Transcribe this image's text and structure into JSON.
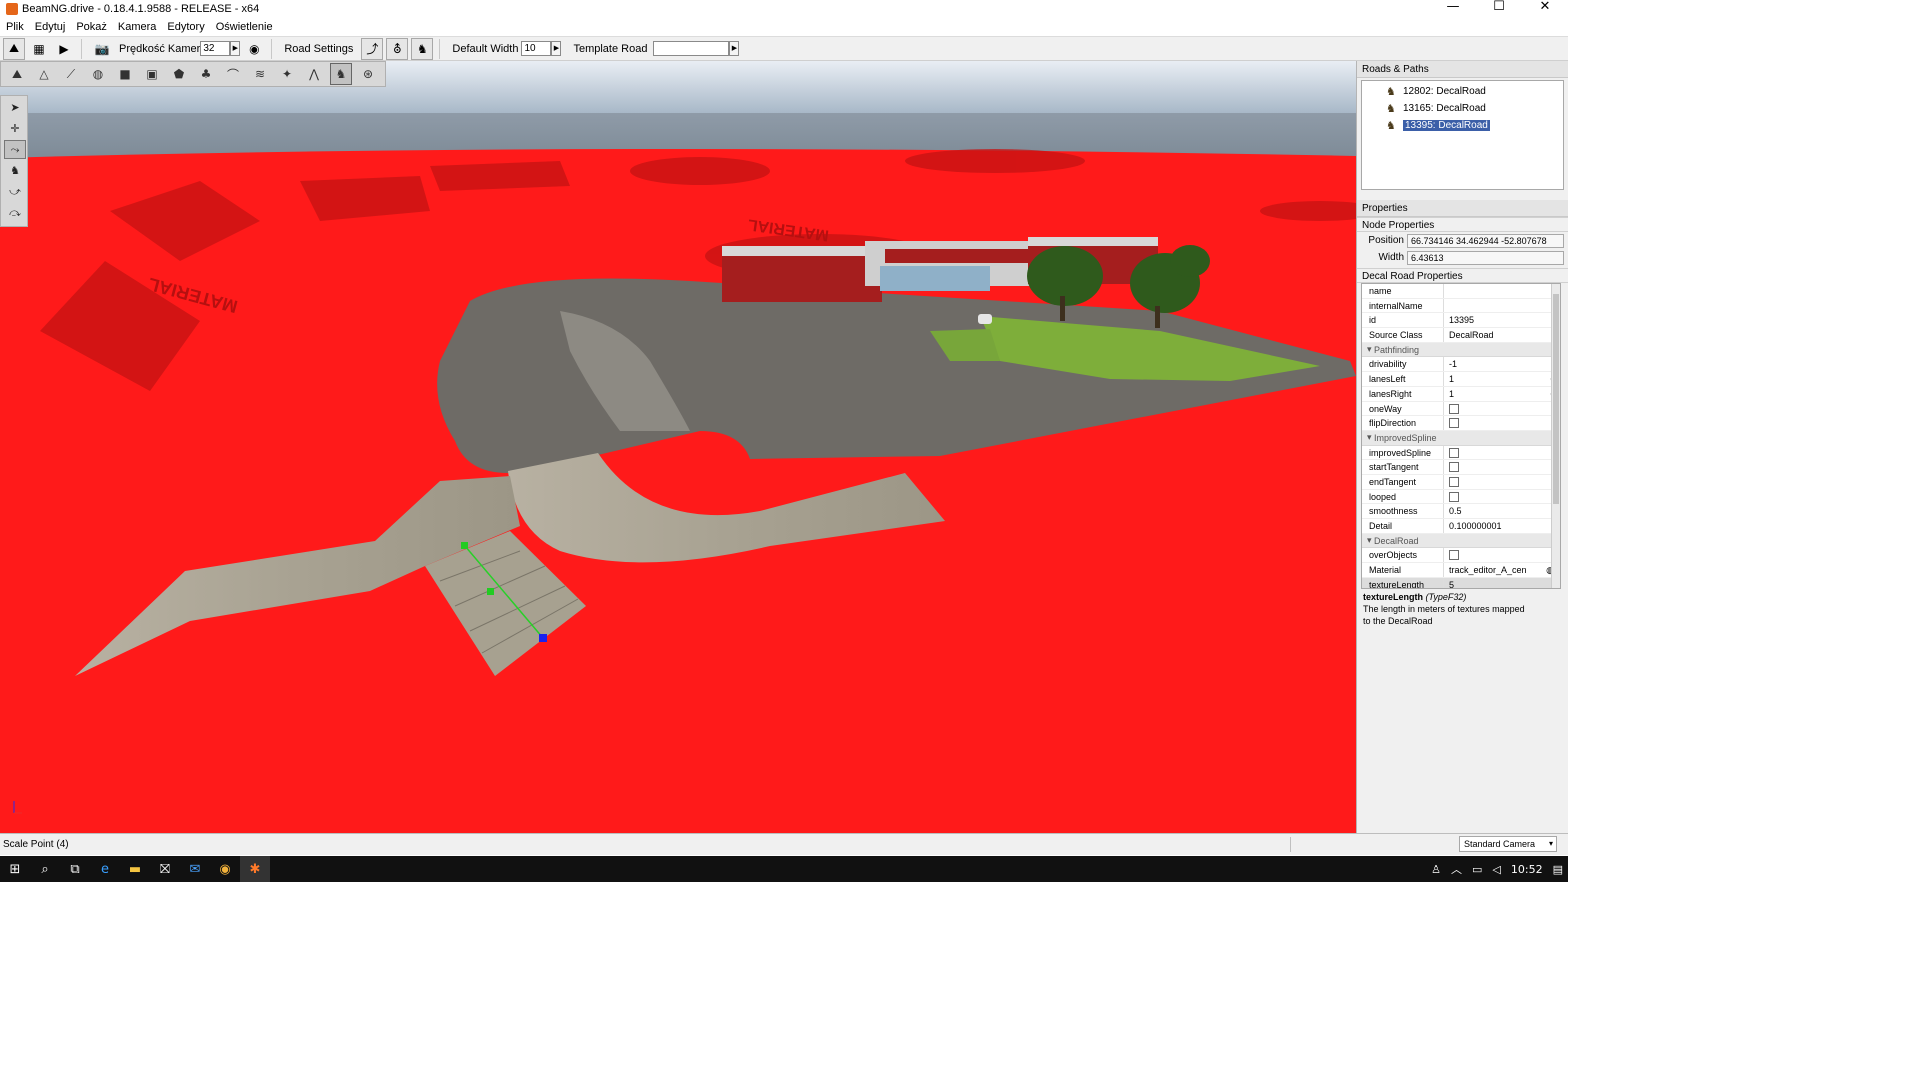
{
  "window": {
    "title": "BeamNG.drive - 0.18.4.1.9588 - RELEASE - x64",
    "minimize": "—",
    "maximize": "☐",
    "close": "✕"
  },
  "menu": [
    "Plik",
    "Edytuj",
    "Pokaż",
    "Kamera",
    "Edytory",
    "Oświetlenie"
  ],
  "toolbar": {
    "camera_speed_label": "Prędkość Kamer",
    "camera_speed_value": "32",
    "road_settings_label": "Road Settings",
    "default_width_label": "Default Width",
    "default_width_value": "10",
    "template_road_label": "Template Road",
    "template_road_value": ""
  },
  "viewport": {
    "ground_texts": [
      "MATERIAL",
      "MATERIAL"
    ]
  },
  "roads_panel": {
    "title": "Roads & Paths",
    "items": [
      {
        "label": "12802: DecalRoad",
        "selected": false
      },
      {
        "label": "13165: DecalRoad",
        "selected": false
      },
      {
        "label": "13395: DecalRoad",
        "selected": true
      }
    ]
  },
  "properties_panel": {
    "title": "Properties",
    "node_title": "Node Properties",
    "position_label": "Position",
    "position_value": "66.734146 34.462944 -52.807678",
    "width_label": "Width",
    "width_value": "6.43613",
    "decal_title": "Decal Road Properties",
    "rows": [
      {
        "k": "name",
        "v": ""
      },
      {
        "k": "internalName",
        "v": ""
      },
      {
        "k": "id",
        "v": "13395"
      },
      {
        "k": "Source Class",
        "v": "DecalRoad"
      }
    ],
    "pathfinding_group": "Pathfinding",
    "pathfinding": [
      {
        "k": "drivability",
        "v": "-1"
      },
      {
        "k": "lanesLeft",
        "v": "1"
      },
      {
        "k": "lanesRight",
        "v": "1"
      },
      {
        "k": "oneWay",
        "v": ""
      },
      {
        "k": "flipDirection",
        "v": ""
      }
    ],
    "spline_group": "ImprovedSpline",
    "spline": [
      {
        "k": "improvedSpline",
        "v": ""
      },
      {
        "k": "startTangent",
        "v": ""
      },
      {
        "k": "endTangent",
        "v": ""
      },
      {
        "k": "looped",
        "v": ""
      },
      {
        "k": "smoothness",
        "v": "0.5"
      },
      {
        "k": "Detail",
        "v": "0.100000001"
      }
    ],
    "decal_group": "DecalRoad",
    "decal": [
      {
        "k": "overObjects",
        "v": ""
      },
      {
        "k": "Material",
        "v": "track_editor_A_cen"
      },
      {
        "k": "textureLength",
        "v": "5"
      }
    ],
    "help_name": "textureLength",
    "help_type": "(TypeF32)",
    "help_line1": "The length in meters of textures mapped",
    "help_line2": "to the DecalRoad"
  },
  "status": {
    "left": "Scale Point (4)",
    "camera": "Standard Camera"
  },
  "taskbar": {
    "time": "10:52"
  }
}
